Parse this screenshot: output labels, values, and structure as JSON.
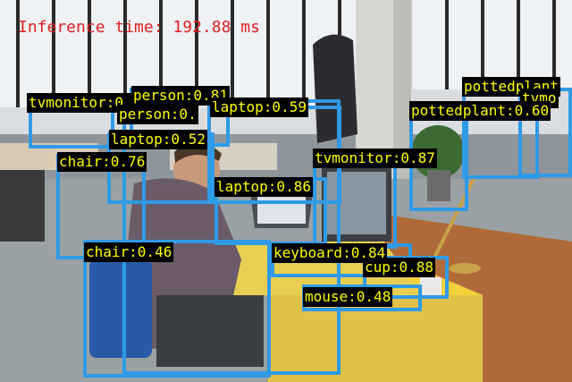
{
  "overlay": {
    "inference_text": "Inference time: 192.88 ms"
  },
  "detections": [
    {
      "label": "tvmonitor:0.72"
    },
    {
      "label": "person:0.81"
    },
    {
      "label": "person:0."
    },
    {
      "label": "laptop:0.59"
    },
    {
      "label": "laptop:0.52"
    },
    {
      "label": "chair:0.76"
    },
    {
      "label": "pottedplant"
    },
    {
      "label": "tvmo"
    },
    {
      "label": "pottedplant:0.60"
    },
    {
      "label": "tvmonitor:0.87"
    },
    {
      "label": "laptop:0.86"
    },
    {
      "label": "chair:0.46"
    },
    {
      "label": "keyboard:0.84"
    },
    {
      "label": "cup:0.88"
    },
    {
      "label": "mouse:0.48"
    }
  ],
  "colors": {
    "box": "#2f9ae6",
    "label_bg": "#000000",
    "label_text": "#ffff00",
    "inference_text": "#e02020"
  }
}
